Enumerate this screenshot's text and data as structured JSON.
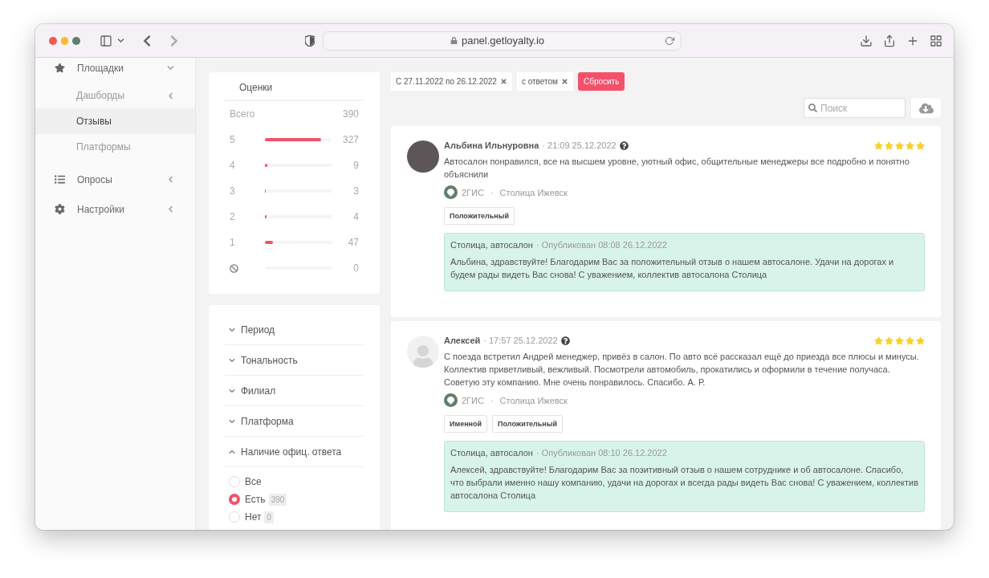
{
  "browser": {
    "url": "panel.getloyalty.io"
  },
  "sidebar": {
    "items": [
      {
        "label": "Площадки",
        "expanded": true,
        "children": [
          {
            "label": "Дашборды",
            "selected": false,
            "expanded": false
          },
          {
            "label": "Отзывы",
            "selected": true
          },
          {
            "label": "Платформы",
            "selected": false
          }
        ]
      },
      {
        "label": "Опросы",
        "expanded": false
      },
      {
        "label": "Настройки",
        "expanded": false
      }
    ]
  },
  "ratings": {
    "title": "Оценки",
    "total_label": "Всего",
    "total": "390",
    "rows": [
      {
        "kind": "score",
        "label": "5",
        "level": 0.84,
        "count": "327"
      },
      {
        "kind": "score",
        "label": "4",
        "level": 0.03,
        "count": "9"
      },
      {
        "kind": "score",
        "label": "3",
        "level": 0.01,
        "count": "3"
      },
      {
        "kind": "score",
        "label": "2",
        "level": 0.02,
        "count": "4"
      },
      {
        "kind": "score",
        "label": "1",
        "level": 0.12,
        "count": "47"
      },
      {
        "kind": "none",
        "level": 0,
        "count": "0"
      }
    ]
  },
  "filters": {
    "sections": [
      {
        "title": "Период",
        "expanded": false
      },
      {
        "title": "Тональность",
        "expanded": false
      },
      {
        "title": "Филиал",
        "expanded": false
      },
      {
        "title": "Платформа",
        "expanded": false
      },
      {
        "title": "Наличие офиц. ответа",
        "expanded": true,
        "options": [
          {
            "label": "Все",
            "selected": false
          },
          {
            "label": "Есть",
            "count": "390",
            "selected": true
          },
          {
            "label": "Нет",
            "count": "0",
            "selected": false
          }
        ]
      }
    ]
  },
  "active_filters": [
    {
      "label": "С 27.11.2022 по 26.12.2022"
    },
    {
      "label": "с ответом"
    }
  ],
  "reset_button": "Сбросить",
  "search": {
    "placeholder": "Поиск"
  },
  "reviews": [
    {
      "kind": "photo",
      "author": "Альбина Ильнуровна",
      "time": "· 21:09 25.12.2022",
      "stars": 5,
      "text": "Автосалон понравился, все на высшем уровне, уютный офис, общительные менеджеры все подробно и понятно объяснили",
      "platform": "2ГИС",
      "separator": "·",
      "branch": "Столица Ижевск",
      "tags": [
        "Положительный"
      ],
      "reply": {
        "author": "Столица, автосалон",
        "published": "· Опубликован 08:08 26.12.2022",
        "text": "Альбина, здравствуйте! Благодарим Вас за положительный отзыв о нашем автосалоне. Удачи на дорогах и будем рады видеть Вас снова! С уважением, коллектив автосалона Столица"
      }
    },
    {
      "kind": "default",
      "author": "Алексей",
      "time": "· 17:57 25.12.2022",
      "stars": 5,
      "text": "С поезда встретил Андрей менеджер, привёз в салон. По авто всё рассказал ещё до приезда все плюсы и минусы. Коллектив приветливый, вежливый. Посмотрели автомобиль, прокатились и оформили в течение получаса. Советую эту компанию. Мне очень понравилось. Спасибо. А. Р.",
      "platform": "2ГИС",
      "separator": "·",
      "branch": "Столица Ижевск",
      "tags": [
        "Именной",
        "Положительный"
      ],
      "reply": {
        "author": "Столица, автосалон",
        "published": "· Опубликован 08:10 26.12.2022",
        "text": "Алексей, здравствуйте! Благодарим Вас за позитивный отзыв о нашем сотруднике и об автосалоне. Спасибо, что выбрали именно нашу компанию, удачи на дорогах и всегда рады видеть Вас снова! С уважением, коллектив автосалона Столица"
      }
    }
  ]
}
